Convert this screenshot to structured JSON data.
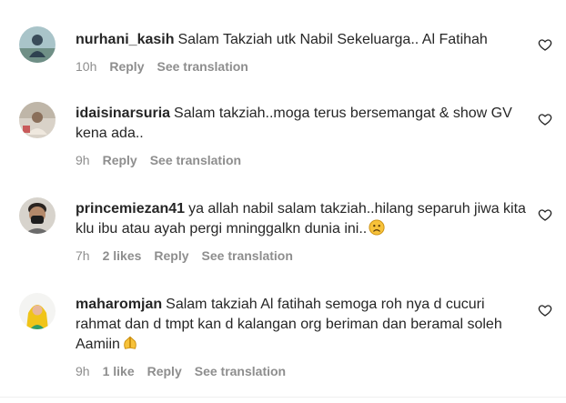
{
  "comments": [
    {
      "username": "nurhani_kasih",
      "text": "Salam Takziah utk Nabil Sekeluarga.. Al Fatihah",
      "time": "10h",
      "likes": "",
      "reply_label": "Reply",
      "translate_label": "See translation",
      "avatar_icon": "user-avatar-photo"
    },
    {
      "username": "idaisinarsuria",
      "text": "Salam takziah..moga terus bersemangat & show GV kena ada..",
      "time": "9h",
      "likes": "",
      "reply_label": "Reply",
      "translate_label": "See translation",
      "avatar_icon": "user-avatar-photo"
    },
    {
      "username": "princemiezan41",
      "text": "ya allah nabil salam takziah..hilang separuh jiwa kita klu ibu atau ayah pergi mninggalkn dunia ini..",
      "emoji": "sad-face-emoji",
      "time": "7h",
      "likes": "2 likes",
      "reply_label": "Reply",
      "translate_label": "See translation",
      "avatar_icon": "user-avatar-photo"
    },
    {
      "username": "maharomjan",
      "text": "Salam takziah Al fatihah semoga roh nya d cucuri rahmat dan d tmpt kan d kalangan org beriman dan beramal soleh Aamiin",
      "emoji": "praying-hands-emoji",
      "time": "9h",
      "likes": "1 like",
      "reply_label": "Reply",
      "translate_label": "See translation",
      "avatar_icon": "user-avatar-photo"
    }
  ],
  "colors": {
    "text": "#262626",
    "secondary": "#8e8e8e",
    "divider": "#efefef"
  }
}
